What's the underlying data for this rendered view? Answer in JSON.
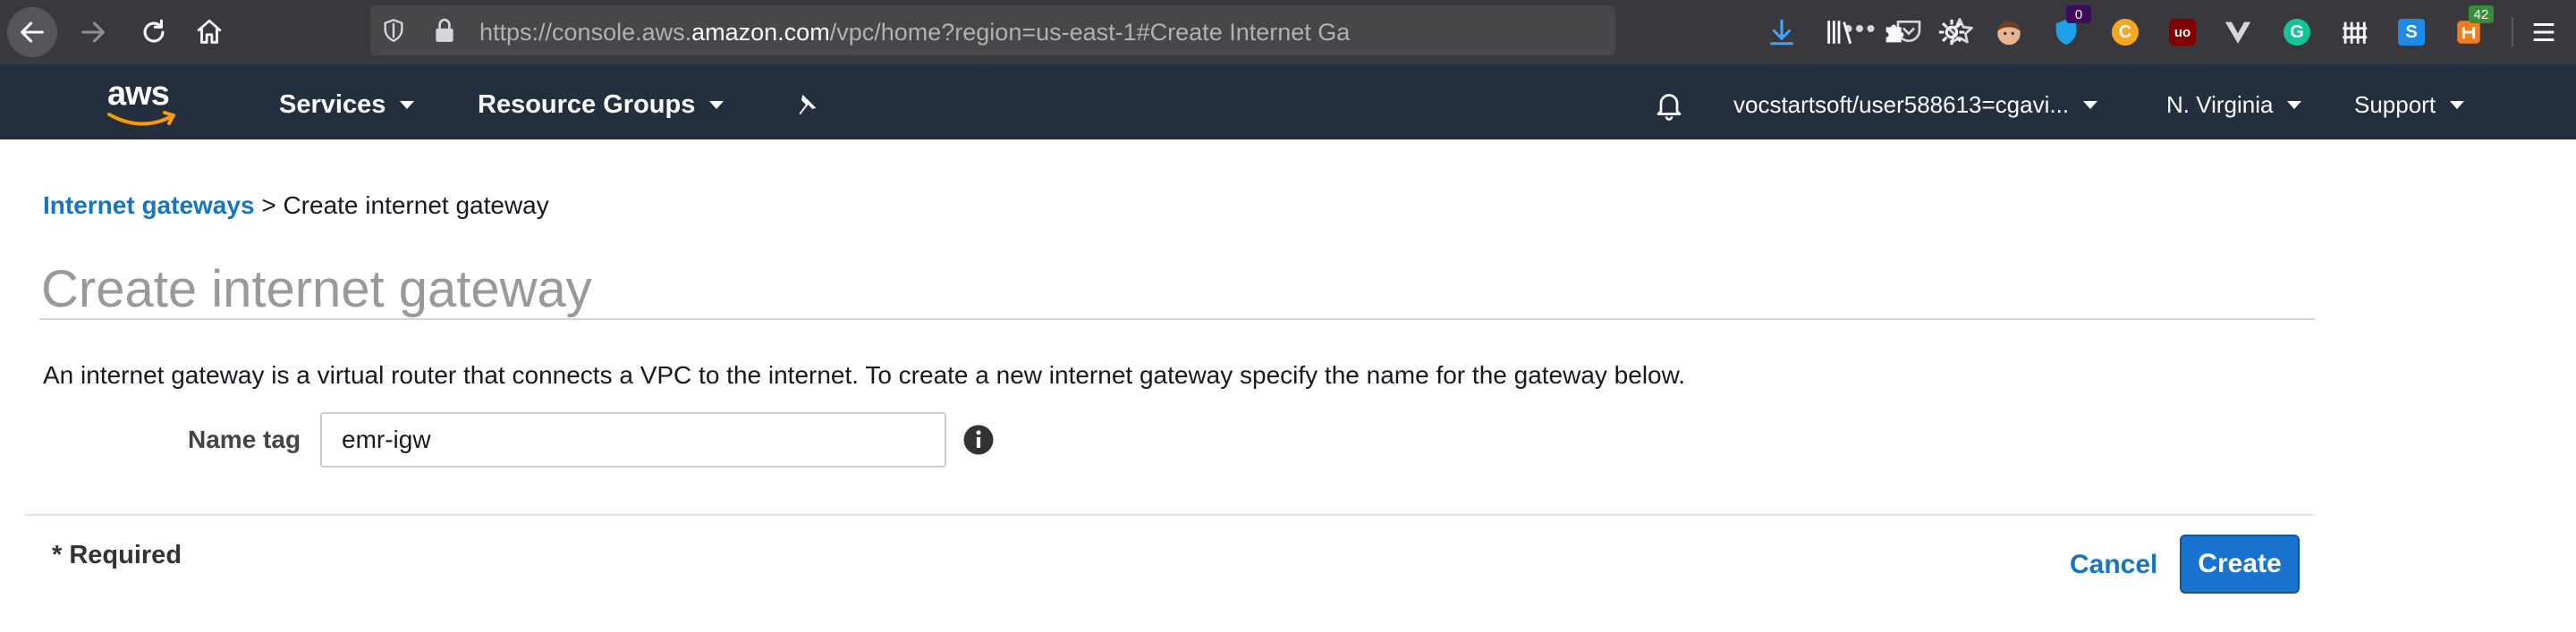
{
  "browser": {
    "url_prefix": "https://console.aws.",
    "url_domain": "amazon.com",
    "url_suffix": "/vpc/home?region=us-east-1#Create Internet Ga",
    "more_label": "•••",
    "extension_badges": {
      "shield_counter": "0",
      "sheets_counter": "42"
    },
    "extension_letters": {
      "c_ext": "C",
      "ublock": "uo",
      "grammarly": "G",
      "s_ext": "S"
    }
  },
  "aws_nav": {
    "logo_text": "aws",
    "services_label": "Services",
    "resource_groups_label": "Resource Groups",
    "account_label": "vocstartsoft/user588613=cgavi...",
    "region_label": "N. Virginia",
    "support_label": "Support"
  },
  "breadcrumb": {
    "parent_link": "Internet gateways",
    "separator": ">",
    "current": "Create internet gateway"
  },
  "page": {
    "title": "Create internet gateway",
    "description": "An internet gateway is a virtual router that connects a VPC to the internet. To create a new internet gateway specify the name for the gateway below."
  },
  "form": {
    "name_tag_label": "Name tag",
    "name_tag_value": "emr-igw",
    "required_note": "* Required"
  },
  "actions": {
    "cancel_label": "Cancel",
    "create_label": "Create"
  },
  "colors": {
    "aws_nav_bg": "#232f3e",
    "browser_bg": "#38383d",
    "link_blue": "#1575c1",
    "primary_button": "#1a73cf"
  }
}
